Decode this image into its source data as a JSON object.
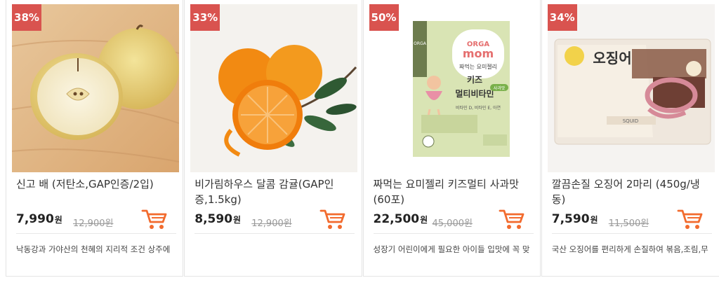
{
  "products": [
    {
      "discount": "38%",
      "image": "asian-pear-halved",
      "title": "신고 배 (저탄소,GAP인증/2입)",
      "price": "7,990",
      "unit": "원",
      "original_price": "12,900원",
      "description": "낙동강과 가야산의 천혜의 지리적 조건 상주에"
    },
    {
      "discount": "33%",
      "image": "tangerines-with-leaves",
      "title": "비가림하우스 달콤 감귤(GAP인증,1.5kg)",
      "price": "8,590",
      "unit": "원",
      "original_price": "12,900원",
      "description": ""
    },
    {
      "discount": "50%",
      "image": "orgamom-kids-jelly-package",
      "package_text": {
        "brand_small": "ORGA",
        "brand_top": "ORGA",
        "brand_bottom": "mom",
        "line1": "짜먹는 요미젤리",
        "line2": "키즈",
        "line3": "멀티비타민",
        "tag": "사과맛",
        "note": "비타민 D, 비타민 E, 아연"
      },
      "title": "짜먹는 요미젤리 키즈멀티 사과맛 (60포)",
      "price": "22,500",
      "unit": "원",
      "original_price": "45,000원",
      "description": "성장기 어린이에게 필요한 아이들 입맛에 꼭 맞"
    },
    {
      "discount": "34%",
      "image": "frozen-squid-package",
      "package_text": {
        "label": "오징어",
        "sub": "SQUID"
      },
      "title": "깔끔손질 오징어 2마리 (450g/냉동)",
      "price": "7,590",
      "unit": "원",
      "original_price": "11,500원",
      "description": "국산 오징어를 편리하게 손질하여 볶음,조림,무"
    }
  ],
  "colors": {
    "badge": "#d9534f",
    "cart": "#f26b2e"
  },
  "icons": {
    "cart": "shopping-cart-icon"
  }
}
